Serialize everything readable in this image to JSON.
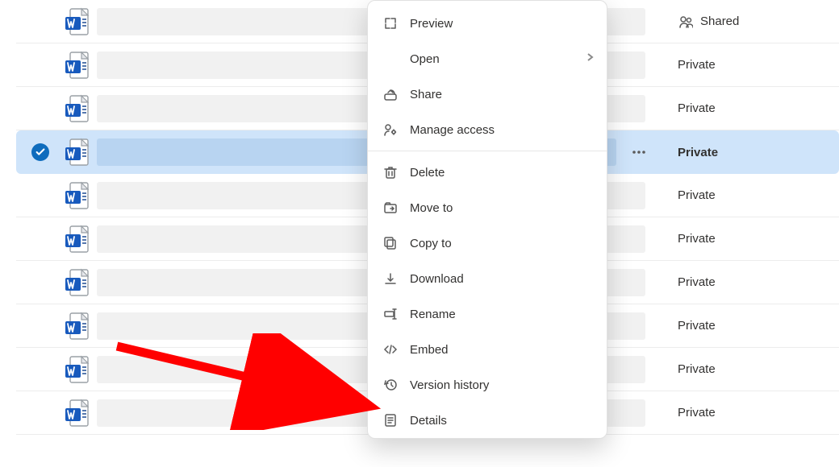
{
  "sharing_labels": {
    "shared": "Shared",
    "private": "Private"
  },
  "rows": [
    {
      "sharing": "shared",
      "show_shared_icon": true
    },
    {
      "sharing": "private"
    },
    {
      "sharing": "private"
    },
    {
      "sharing": "private",
      "selected": true,
      "show_more_btn": true
    },
    {
      "sharing": "private"
    },
    {
      "sharing": "private"
    },
    {
      "sharing": "private"
    },
    {
      "sharing": "private"
    },
    {
      "sharing": "private"
    },
    {
      "sharing": "private"
    }
  ],
  "context_menu": {
    "groups": [
      [
        {
          "icon": "preview-icon",
          "label": "Preview"
        },
        {
          "icon": null,
          "label": "Open",
          "submenu": true
        },
        {
          "icon": "share-icon",
          "label": "Share"
        },
        {
          "icon": "access-icon",
          "label": "Manage access"
        }
      ],
      [
        {
          "icon": "delete-icon",
          "label": "Delete"
        },
        {
          "icon": "moveto-icon",
          "label": "Move to"
        },
        {
          "icon": "copyto-icon",
          "label": "Copy to"
        },
        {
          "icon": "download-icon",
          "label": "Download"
        },
        {
          "icon": "rename-icon",
          "label": "Rename"
        },
        {
          "icon": "embed-icon",
          "label": "Embed"
        },
        {
          "icon": "history-icon",
          "label": "Version history"
        },
        {
          "icon": "details-icon",
          "label": "Details"
        }
      ]
    ]
  }
}
